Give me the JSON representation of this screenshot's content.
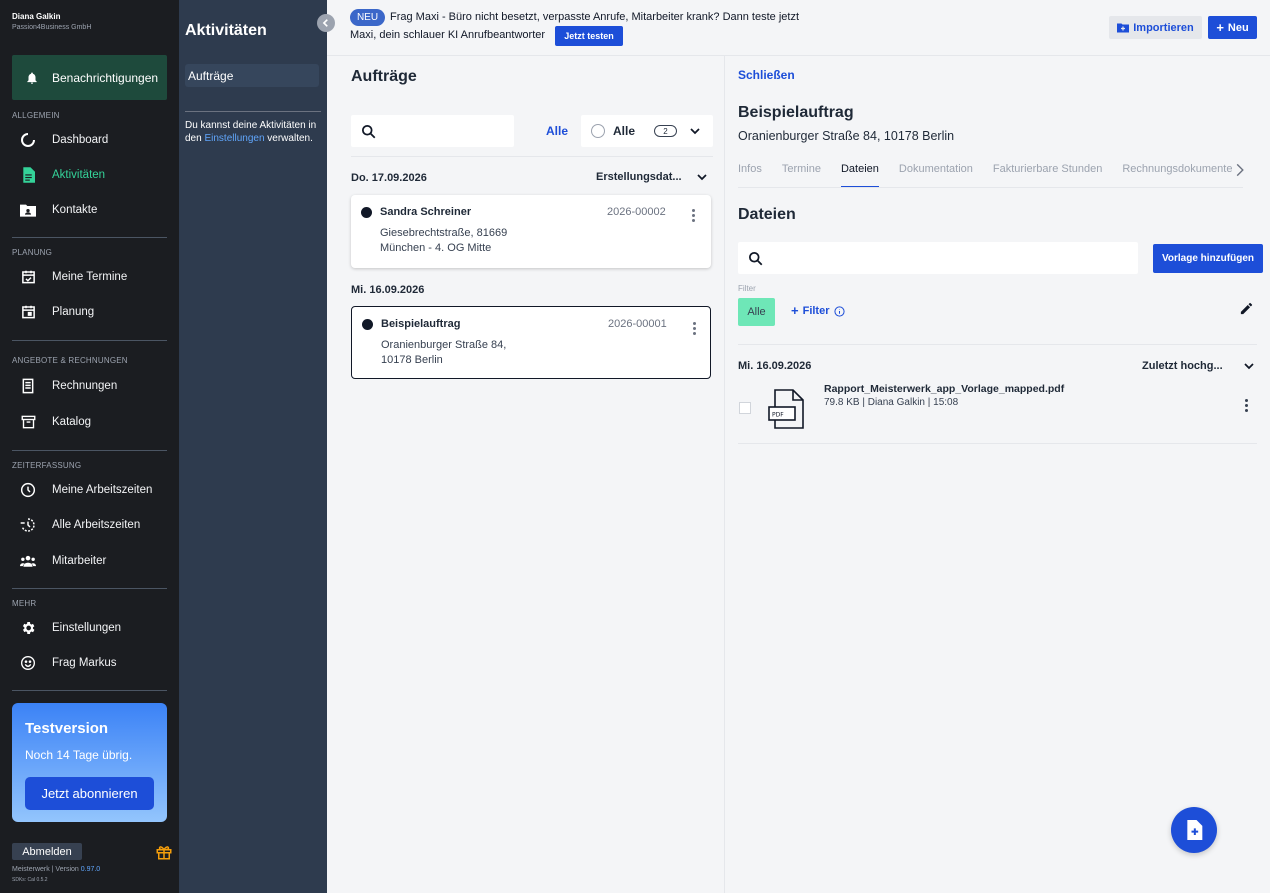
{
  "user": {
    "name": "Diana Galkin",
    "company": "Passion4Business GmbH"
  },
  "notifications": {
    "label": "Benachrichtigungen",
    "icon": "bell-icon"
  },
  "nav": {
    "sections": [
      {
        "label": "ALLGEMEIN"
      },
      {
        "label": "PLANUNG"
      },
      {
        "label": "ANGEBOTE & RECHNUNGEN"
      },
      {
        "label": "ZEITERFASSUNG"
      },
      {
        "label": "MEHR"
      }
    ],
    "items": [
      {
        "label": "Dashboard",
        "icon": "dashboard-icon"
      },
      {
        "label": "Aktivitäten",
        "icon": "document-icon",
        "active": true
      },
      {
        "label": "Kontakte",
        "icon": "contact-card-icon"
      },
      {
        "label": "Meine Termine",
        "icon": "calendar-check-icon"
      },
      {
        "label": "Planung",
        "icon": "calendar-icon"
      },
      {
        "label": "Rechnungen",
        "icon": "receipt-icon"
      },
      {
        "label": "Katalog",
        "icon": "archive-icon"
      },
      {
        "label": "Meine Arbeitszeiten",
        "icon": "clock-icon"
      },
      {
        "label": "Alle Arbeitszeiten",
        "icon": "history-icon"
      },
      {
        "label": "Mitarbeiter",
        "icon": "people-icon"
      },
      {
        "label": "Einstellungen",
        "icon": "gear-icon"
      },
      {
        "label": "Frag Markus",
        "icon": "smiley-icon"
      }
    ],
    "active_color": "#34d399"
  },
  "trial": {
    "title": "Testversion",
    "subtitle": "Noch 14 Tage übrig.",
    "button": "Jetzt abonnieren"
  },
  "footer": {
    "logout": "Abmelden",
    "version_prefix": "Meisterwerk | Version ",
    "version": "0.97.0",
    "sdk": "SDKs: Cal 0.5.2"
  },
  "subnav": {
    "title": "Aktivitäten",
    "item": "Aufträge",
    "hint_before": "Du kannst deine Aktivitäten in den ",
    "hint_link": "Einstellungen",
    "hint_after": " verwalten."
  },
  "topbar": {
    "badge": "NEU",
    "promo_line1": "Frag Maxi - Büro nicht besetzt, verpasste Anrufe, Mitarbeiter krank? Dann teste jetzt",
    "promo_line2": "Maxi, dein schlauer KI Anrufbeantworter",
    "promo_button": "Jetzt testen",
    "import_label": "Importieren",
    "new_label": "Neu"
  },
  "list": {
    "title": "Aufträge",
    "search_placeholder": "",
    "filter_all": "Alle",
    "dropdown_label": "Alle",
    "dropdown_count": "2",
    "sort_label": "Erstellungsdat...",
    "groups": [
      {
        "date": "Do. 17.09.2026",
        "order": {
          "name": "Sandra Schreiner",
          "number": "2026-00002",
          "address": "Giesebrechtstraße, 81669\nMünchen - 4. OG Mitte"
        }
      },
      {
        "date": "Mi. 16.09.2026",
        "order": {
          "name": "Beispielauftrag",
          "number": "2026-00001",
          "address": "Oranienburger Straße 84,\n10178 Berlin"
        }
      }
    ]
  },
  "detail": {
    "close": "Schließen",
    "title": "Beispielauftrag",
    "address": "Oranienburger Straße 84, 10178 Berlin",
    "tabs": [
      "Infos",
      "Termine",
      "Dateien",
      "Dokumentation",
      "Fakturierbare Stunden",
      "Rechnungsdokumente"
    ],
    "active_tab": "Dateien",
    "section_title": "Dateien",
    "template_button": "Vorlage hinzufügen",
    "filter_label": "Filter",
    "filter_chip": "Alle",
    "filter_button": "Filter",
    "file_group_date": "Mi. 16.09.2026",
    "file_sort": "Zuletzt hochg...",
    "file": {
      "name": "Rapport_Meisterwerk_app_Vorlage_mapped.pdf",
      "meta": "79.8 KB | Diana Galkin | 15:08",
      "icon_text": "PDF"
    }
  }
}
